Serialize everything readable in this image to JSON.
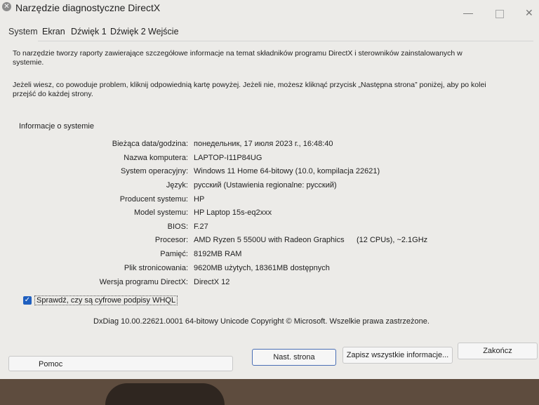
{
  "window": {
    "title": "Narzędzie diagnostyczne DirectX",
    "controls": {
      "minimize": "—",
      "maximize": "",
      "close": "✕"
    }
  },
  "tabs": [
    {
      "label": "System",
      "active": true
    },
    {
      "label": "Ekran",
      "active": false
    },
    {
      "label": "Dźwięk 1",
      "active": false
    },
    {
      "label": "Dźwięk 2",
      "active": false
    },
    {
      "label": "Wejście",
      "active": false
    }
  ],
  "intro": {
    "paragraph1": "To narzędzie tworzy raporty zawierające szczegółowe informacje na temat składników programu DirectX i sterowników zainstalowanych w systemie.",
    "paragraph2": "Jeżeli wiesz, co powoduje problem, kliknij odpowiednią kartę powyżej. Jeżeli nie, możesz kliknąć przycisk „Następna strona” poniżej, aby po kolei przejść do każdej strony."
  },
  "system_info": {
    "group_title": "Informacje o systemie",
    "rows": [
      {
        "label": "Bieżąca data/godzina:",
        "value": "понедельник, 17 июля 2023 г., 16:48:40"
      },
      {
        "label": "Nazwa komputera:",
        "value": "LAPTOP-I11P84UG"
      },
      {
        "label": "System operacyjny:",
        "value": "Windows 11 Home 64-bitowy (10.0, kompilacja 22621)"
      },
      {
        "label": "Język:",
        "value": "русский (Ustawienia regionalne: русский)"
      },
      {
        "label": "Producent systemu:",
        "value": "HP"
      },
      {
        "label": "Model systemu:",
        "value": "HP Laptop 15s-eq2xxx"
      },
      {
        "label": "BIOS:",
        "value": "F.27"
      },
      {
        "label": "Procesor:",
        "value": "AMD Ryzen 5 5500U with Radeon Graphics",
        "extra": "(12 CPUs), ~2.1GHz"
      },
      {
        "label": "Pamięć:",
        "value": "8192MB RAM"
      },
      {
        "label": "Plik stronicowania:",
        "value": "9620MB użytych, 18361MB dostępnych"
      },
      {
        "label": "Wersja programu DirectX:",
        "value": "DirectX 12"
      }
    ]
  },
  "whql_check": {
    "label": "Sprawdź, czy są cyfrowe podpisy WHQL",
    "checked": true
  },
  "copyright": "DxDiag 10.00.22621.0001 64-bitowy Unicode  Copyright © Microsoft. Wszelkie prawa zastrzeżone.",
  "buttons": {
    "help": "Pomoc",
    "next": "Nast. strona",
    "save": "Zapisz wszystkie informacje...",
    "exit": "Zakończ"
  },
  "colors": {
    "checkbox": "#1f5fbf",
    "window_bg": "#ecebe8"
  }
}
